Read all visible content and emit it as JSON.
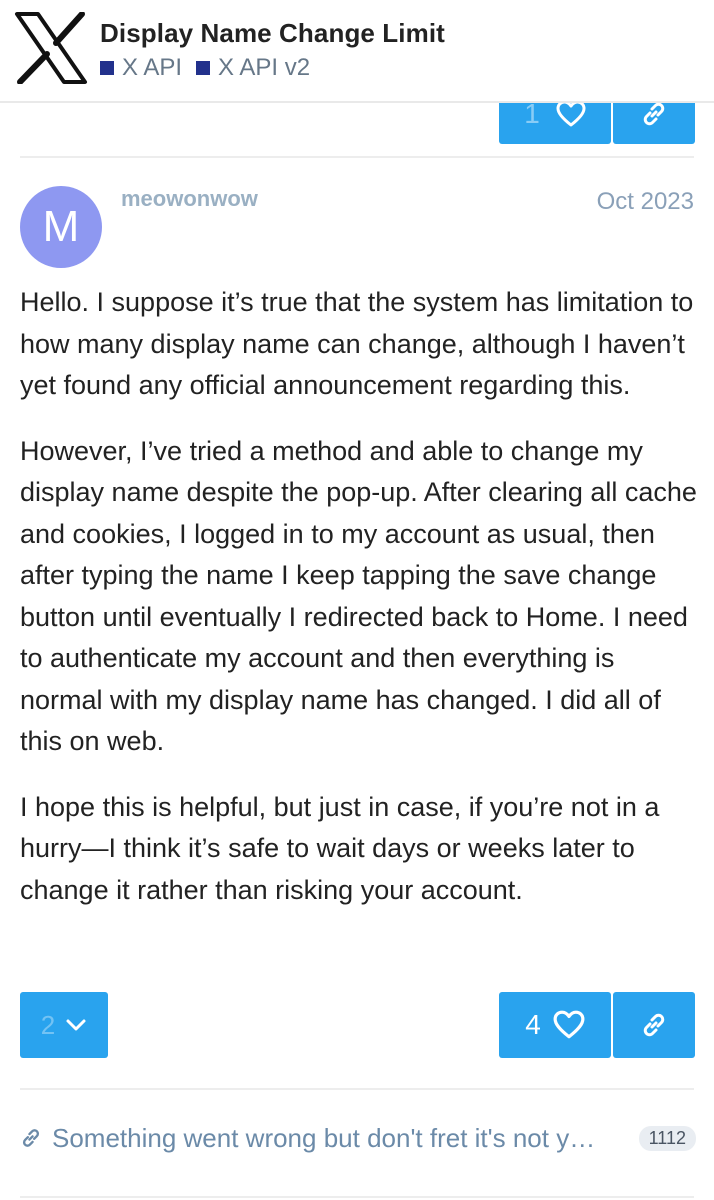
{
  "header": {
    "title": "Display Name Change Limit",
    "categories": [
      {
        "label": "X API",
        "color": "#22318c"
      },
      {
        "label": "X API v2",
        "color": "#22318c"
      }
    ]
  },
  "previous_post": {
    "like_count": "1"
  },
  "post": {
    "avatar_letter": "M",
    "avatar_color": "#8e98f1",
    "username": "meowonwow",
    "date": "Oct 2023",
    "paragraphs": [
      "Hello. I suppose it’s true that the system has limitation to how many display name can change, although I haven’t yet found any official announcement regarding this.",
      "However, I’ve tried a method and able to change my display name despite the pop-up. After clearing all cache and cookies, I logged in to my account as usual, then after typing the name I keep tapping the save change button until eventually I redirected back to Home. I need to authenticate my account and then everything is normal with my display name has changed. I did all of this on web.",
      "I hope this is helpful, but just in case, if you’re not in a hurry—I think it’s safe to wait days or weeks later to change it rather than risking your account."
    ],
    "replies_count": "2",
    "like_count": "4"
  },
  "link_preview": {
    "text": "Something went wrong but don't fret it's not y…",
    "clicks": "1112"
  },
  "colors": {
    "accent": "#29a3ee",
    "link": "#6b8aa8"
  }
}
